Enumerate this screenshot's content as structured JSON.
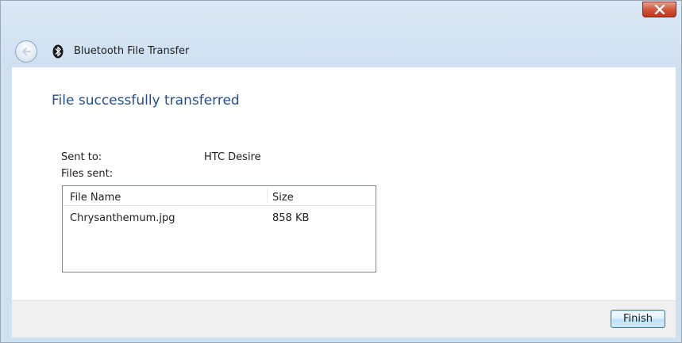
{
  "window": {
    "title": "Bluetooth File Transfer",
    "close_glyph": "x",
    "back_icon": "back-arrow-icon",
    "app_icon": "bluetooth-icon"
  },
  "main": {
    "heading": "File successfully transferred",
    "sent_to_label": "Sent to:",
    "sent_to_value": "HTC Desire",
    "files_sent_label": "Files sent:",
    "file_list": {
      "columns": [
        "File Name",
        "Size"
      ],
      "rows": [
        {
          "name": "Chrysanthemum.jpg",
          "size": "858 KB"
        }
      ]
    }
  },
  "footer": {
    "finish_label": "Finish"
  },
  "colors": {
    "heading": "#1f4f99",
    "chrome": "#cfe0f1",
    "close_button": "#c1361b"
  }
}
